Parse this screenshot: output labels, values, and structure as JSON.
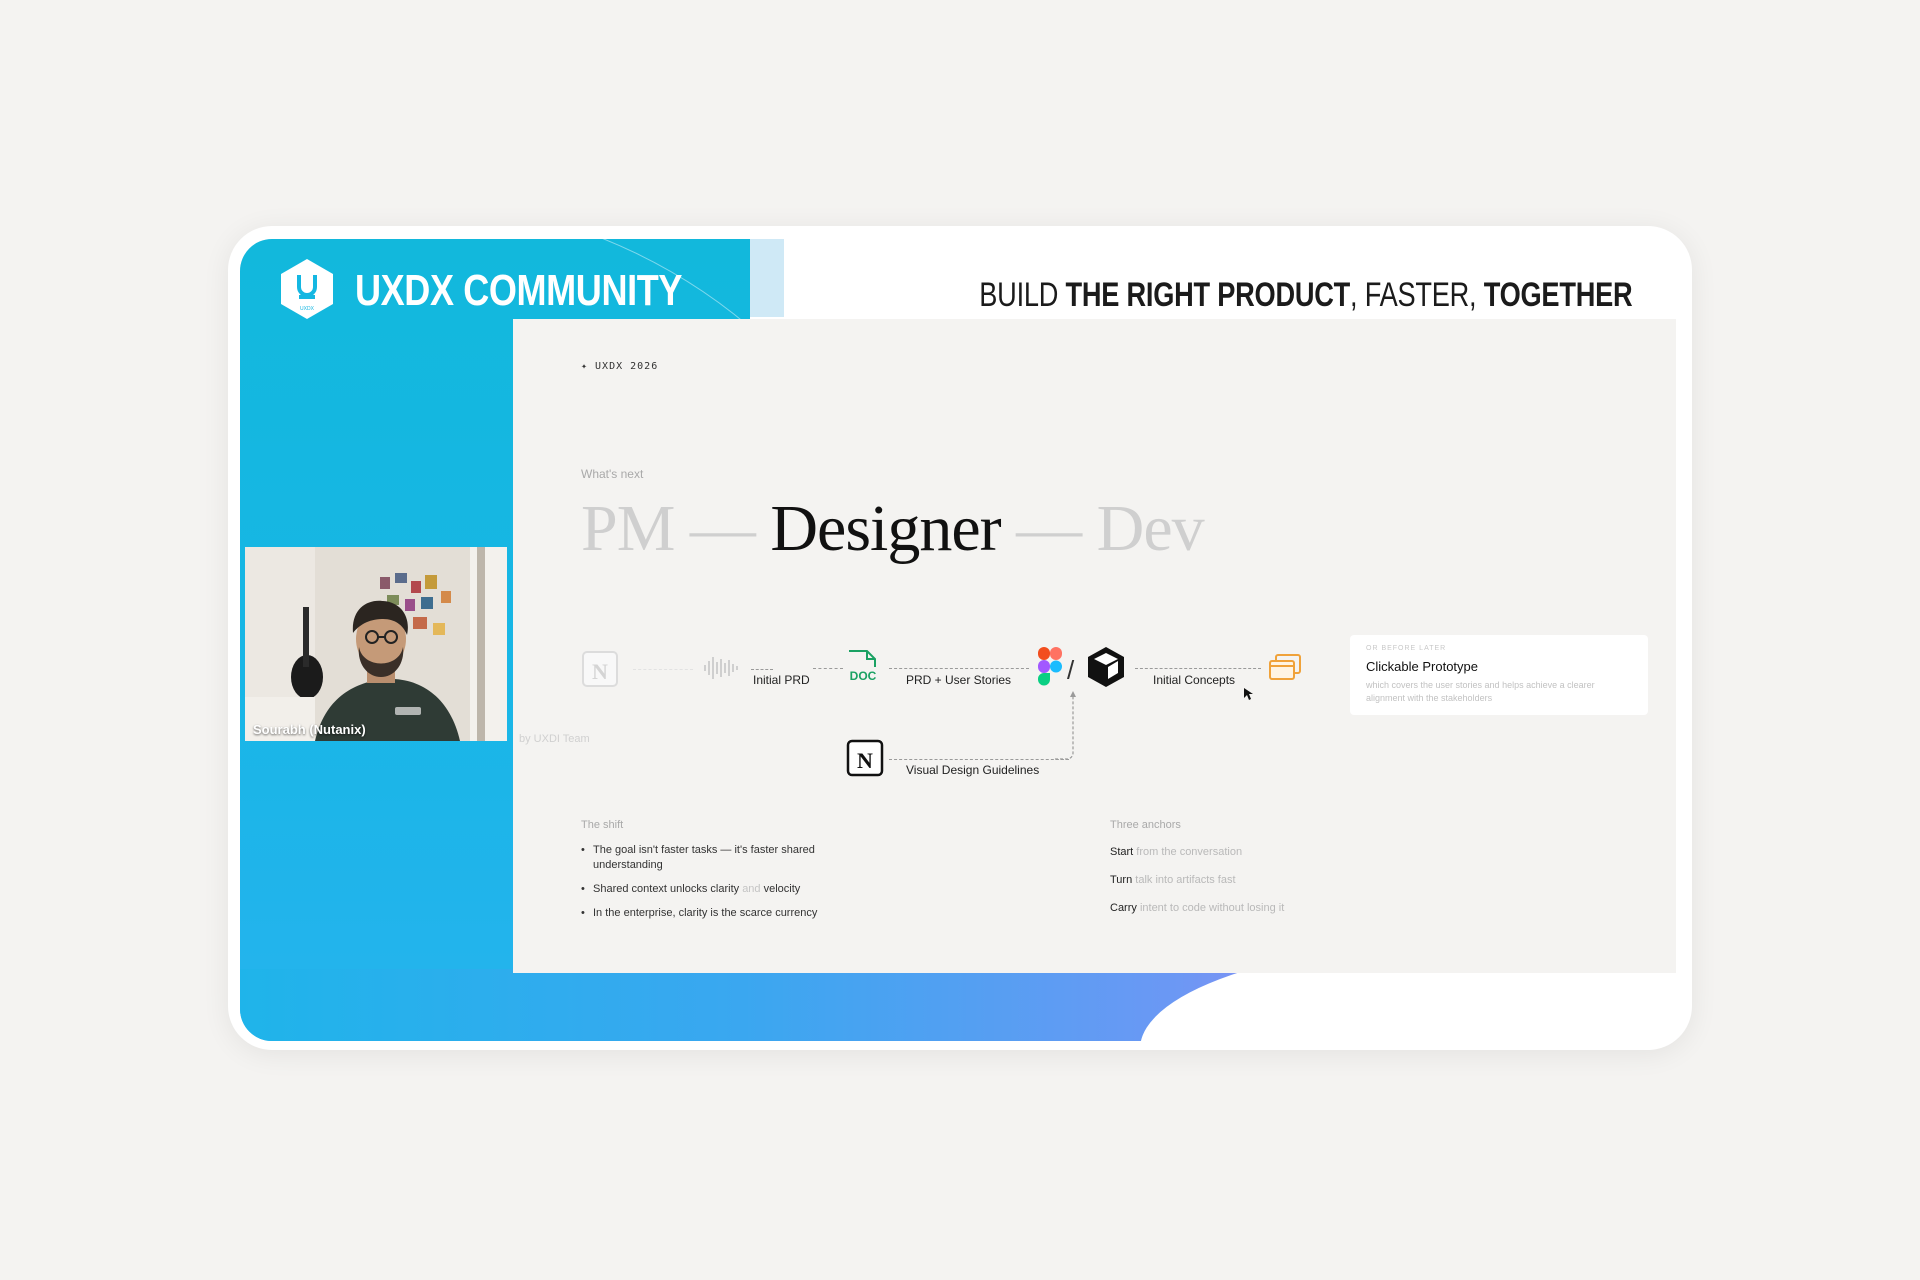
{
  "brand": {
    "community_title": "UXDX COMMUNITY",
    "logo_text": "UXDX",
    "tagline_parts": [
      {
        "text": "BUILD ",
        "bold": false
      },
      {
        "text": "THE RIGHT PRODUCT",
        "bold": true
      },
      {
        "text": ", FASTER, ",
        "bold": false
      },
      {
        "text": "TOGETHER",
        "bold": true
      }
    ],
    "accent_color": "#14b7e2"
  },
  "slide": {
    "tag": "✦ UXDX 2026",
    "subtitle": "What's next",
    "roles": {
      "left": "PM —",
      "center": "Designer",
      "right": "— Dev"
    },
    "flow": {
      "faded_label": "by UXDI Team",
      "initial_prd": "Initial PRD",
      "prd_user_stories": "PRD + User Stories",
      "initial_concepts": "Initial Concepts",
      "visual_design_guidelines": "Visual Design Guidelines",
      "doc_label": "DOC",
      "slash": "/"
    },
    "prototype_card": {
      "small": "OR BEFORE LATER",
      "title": "Clickable Prototype",
      "description": "which covers the user stories and helps achieve a clearer alignment with the stakeholders"
    },
    "shift": {
      "title": "The shift",
      "bullets": [
        {
          "text": "The goal isn't faster tasks — it's faster shared understanding"
        },
        {
          "pre": "Shared context unlocks clarity ",
          "light": "and",
          "post": " velocity"
        },
        {
          "text": "In the enterprise, clarity is the scarce currency"
        }
      ]
    },
    "anchors": {
      "title": "Three anchors",
      "items": [
        {
          "key": "Start",
          "value": " from the conversation"
        },
        {
          "key": "Turn",
          "value": " talk into artifacts fast"
        },
        {
          "key": "Carry",
          "value": " intent to code without losing it"
        }
      ]
    }
  },
  "video": {
    "speaker_name": "Sourabh (Nutanix)"
  }
}
